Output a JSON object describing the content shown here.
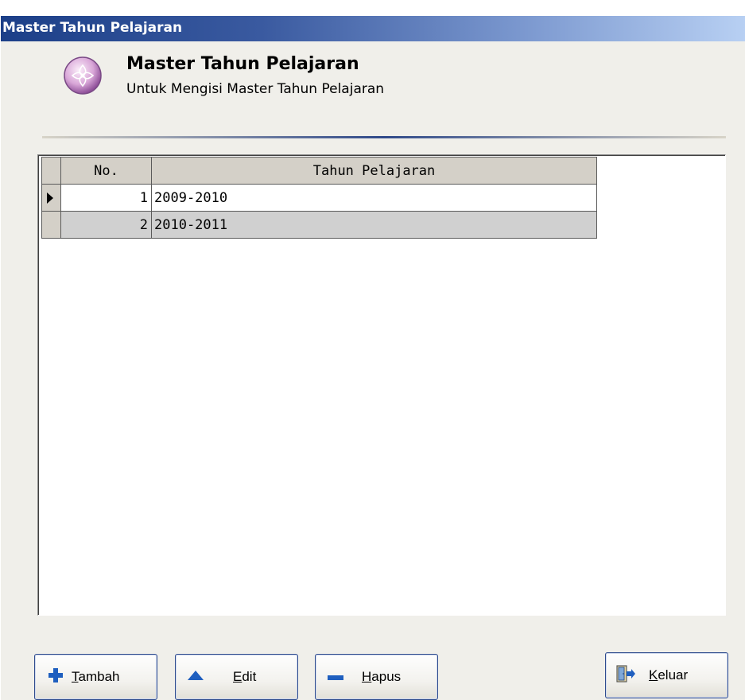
{
  "window": {
    "title": "Master Tahun Pelajaran"
  },
  "header": {
    "title": "Master Tahun Pelajaran",
    "subtitle": "Untuk Mengisi Master Tahun Pelajaran",
    "icon": "flower-icon"
  },
  "grid": {
    "columns": [
      "No.",
      "Tahun Pelajaran"
    ],
    "rows": [
      {
        "no": "1",
        "tahun": "2009-2010"
      },
      {
        "no": "2",
        "tahun": "2010-2011"
      }
    ]
  },
  "buttons": {
    "tambah": {
      "mnemonic": "T",
      "rest": "ambah",
      "icon": "plus-icon"
    },
    "edit": {
      "mnemonic": "E",
      "rest": "dit",
      "icon": "triangle-up-icon"
    },
    "hapus": {
      "mnemonic": "H",
      "rest": "apus",
      "icon": "minus-icon"
    },
    "keluar": {
      "mnemonic": "K",
      "rest": "eluar",
      "icon": "exit-door-icon"
    }
  },
  "colors": {
    "titlebar_start": "#1c3f88",
    "titlebar_end": "#b8d0f3",
    "button_border": "#2f4c8e",
    "icon_blue": "#1f5fbf"
  }
}
